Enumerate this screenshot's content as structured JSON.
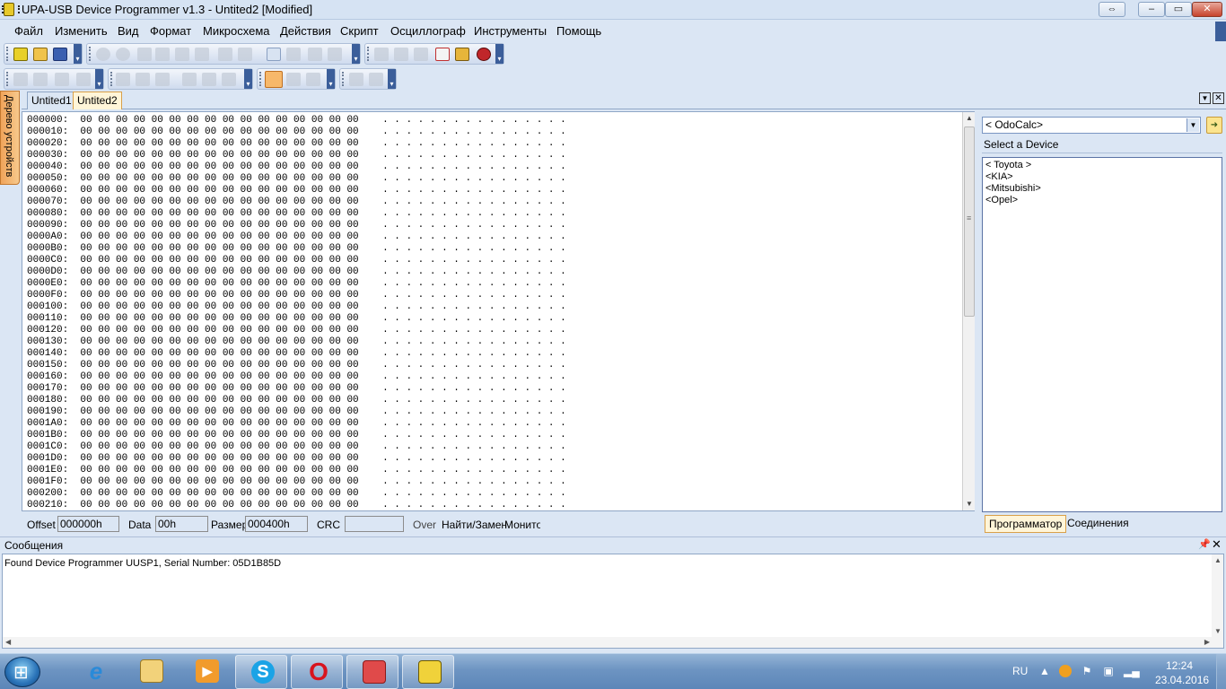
{
  "window": {
    "title": "UPA-USB Device Programmer v1.3 - Untited2 [Modified]"
  },
  "menu": {
    "items": [
      "Файл",
      "Изменить",
      "Вид",
      "Формат",
      "Микросхема",
      "Действия",
      "Скрипт",
      "Осциллограф",
      "Инструменты",
      "Помощь"
    ]
  },
  "toolbar": {
    "row1_icons": [
      "new-icon",
      "open-icon",
      "save-icon",
      "back-icon",
      "forward-icon",
      "cut-icon",
      "copy-icon",
      "paste-icon",
      "delete-icon",
      "find-icon",
      "replace-icon",
      "page-icon",
      "binary-icon",
      "hex-icon",
      "refresh-icon",
      "chip-icon",
      "chip-2-icon",
      "grid-icon",
      "eraser-icon",
      "tools-icon",
      "bug-icon"
    ],
    "row2_icons": [
      "zoom-in-icon",
      "zoom-out-icon",
      "fit-icon",
      "move-icon",
      "bold-icon",
      "italic-icon",
      "underline-icon",
      "align-left-icon",
      "align-center-icon",
      "align-right-icon",
      "pointer-icon",
      "zoom-region-icon",
      "measure-icon",
      "play-icon",
      "stop-icon"
    ]
  },
  "tabs": {
    "docs": [
      "Untited1",
      "Untited2"
    ],
    "active": "Untited2",
    "side_tab": "Дерево устройств"
  },
  "hex": {
    "offsets": [
      "000000:",
      "000010:",
      "000020:",
      "000030:",
      "000040:",
      "000050:",
      "000060:",
      "000070:",
      "000080:",
      "000090:",
      "0000A0:",
      "0000B0:",
      "0000C0:",
      "0000D0:",
      "0000E0:",
      "0000F0:",
      "000100:",
      "000110:",
      "000120:",
      "000130:",
      "000140:",
      "000150:",
      "000160:",
      "000170:",
      "000180:",
      "000190:",
      "0001A0:",
      "0001B0:",
      "0001C0:",
      "0001D0:",
      "0001E0:",
      "0001F0:",
      "000200:",
      "000210:"
    ],
    "byte_value": "00",
    "bytes_per_row": 16,
    "ascii_char": "."
  },
  "status": {
    "offset_label": "Offset",
    "offset_value": "000000h",
    "data_label": "Data",
    "data_value": "00h",
    "size_label": "Размер",
    "size_value": "000400h",
    "crc_label": "CRC",
    "crc_value": "",
    "over": "Over",
    "find": "Найти/Замен",
    "monitor": "Монитор"
  },
  "right_panel": {
    "combo_value": "< OdoCalc>",
    "header": "Select a Device",
    "devices": [
      "< Toyota >",
      "<KIA>",
      "<Mitsubishi>",
      "<Opel>"
    ],
    "tab_programmer": "Программатор",
    "tab_connections": "Соединения"
  },
  "messages": {
    "title": "Сообщения",
    "lines": [
      "Found Device Programmer UUSP1, Serial Number: 05D1B85D"
    ]
  },
  "taskbar": {
    "apps": [
      "ie-icon",
      "explorer-icon",
      "media-player-icon",
      "skype-icon",
      "opera-icon",
      "app-red-icon",
      "upa-chip-icon"
    ],
    "lang": "RU",
    "time": "12:24",
    "date": "23.04.2016"
  }
}
